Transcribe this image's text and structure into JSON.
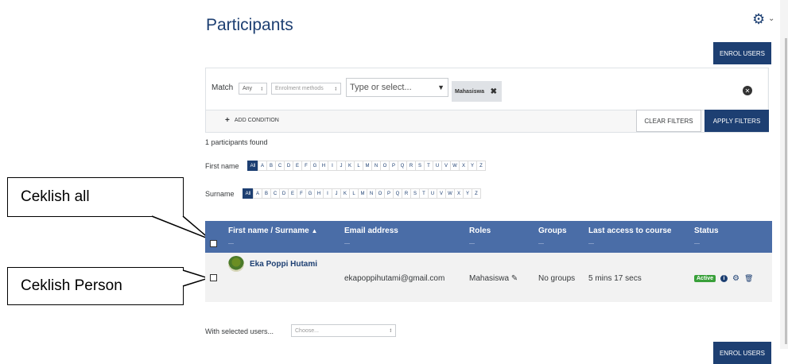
{
  "page": {
    "title": "Participants",
    "enrol_users_label": "ENROL USERS"
  },
  "filters": {
    "match_label": "Match",
    "match_value": "Any",
    "type_value": "Enrolment methods",
    "value_placeholder": "Type or select...",
    "selected_chip": "Mahasiswa",
    "add_condition_label": "ADD CONDITION",
    "clear_label": "CLEAR FILTERS",
    "apply_label": "APPLY FILTERS"
  },
  "results": {
    "count_text": "1 participants found"
  },
  "initials": {
    "firstname_label": "First name",
    "surname_label": "Surname",
    "letters": [
      "All",
      "A",
      "B",
      "C",
      "D",
      "E",
      "F",
      "G",
      "H",
      "I",
      "J",
      "K",
      "L",
      "M",
      "N",
      "O",
      "P",
      "Q",
      "R",
      "S",
      "T",
      "U",
      "V",
      "W",
      "X",
      "Y",
      "Z"
    ]
  },
  "table": {
    "headers": {
      "name": "First name / Surname",
      "email": "Email address",
      "roles": "Roles",
      "groups": "Groups",
      "last_access": "Last access to course",
      "status": "Status"
    },
    "dash": "—",
    "row": {
      "name": "Eka Poppi Hutami",
      "email": "ekapoppihutami@gmail.com",
      "role": "Mahasiswa",
      "groups": "No groups",
      "last_access": "5 mins 17 secs",
      "status": "Active"
    }
  },
  "bulk": {
    "label": "With selected users...",
    "choose_placeholder": "Choose..."
  },
  "callouts": {
    "all": "Ceklish all",
    "person": "Ceklish Person"
  },
  "colors": {
    "brand": "#1d3f72",
    "table_header": "#4a6da7",
    "active_badge": "#39a03a"
  },
  "icons": {
    "settings": "gear-icon",
    "sort": "caret-up-icon",
    "edit_role": "pencil-icon",
    "info": "info-icon",
    "manage": "cog-icon",
    "delete": "trash-icon",
    "remove_chip": "close-icon",
    "clear_row": "circle-close-icon"
  }
}
